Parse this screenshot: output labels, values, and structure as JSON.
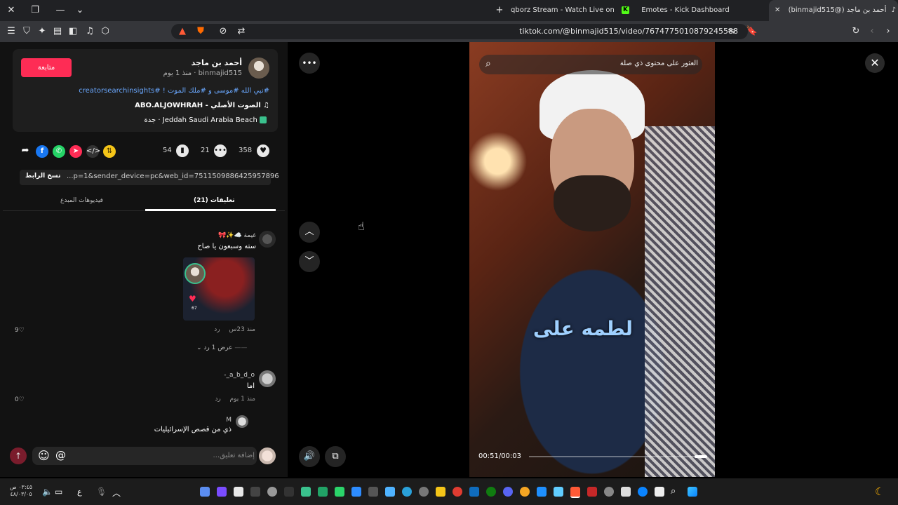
{
  "browser": {
    "tabs": [
      {
        "label": "qborz Stream - Watch Live on Kick"
      },
      {
        "label": "Emotes - Kick Dashboard"
      },
      {
        "label": "(binmajid515@) أحمد بن ماجد"
      }
    ],
    "new_tab": "+",
    "url": "tiktok.com/@binmajid515/video/7674775010879245588"
  },
  "post": {
    "follow_label": "متابعة",
    "author_name": "أحمد بن ماجد",
    "author_meta": "binmajid515 · منذ 1 يوم",
    "caption_tags": "#نبي الله #موسى و #ملك الموت ! #creatorsearchinsights",
    "music": "الصوت الأصلي - ABO.ALJOWHRAH",
    "location": "Jeddah Saudi Arabia Beach · جدة",
    "likes": "358",
    "comments": "21",
    "saves": "54",
    "link_text": "...p=1&sender_device=pc&web_id=7511509886425957896",
    "copy_link_label": "نسخ الرابط"
  },
  "tabs": {
    "comments": "(21) تعليقات",
    "creator_videos": "فيديوهات المبدع"
  },
  "comments": [
    {
      "user": "غيمة ☁️✨🎀",
      "text": "سته وسبعون يا صاح",
      "time": "منذ 23س",
      "reply": "رد",
      "likes": "9",
      "view_replies": "عرض 1 رد",
      "sticker_count": "67"
    },
    {
      "user": "a_b_d_o_-",
      "text": "اما",
      "time": "منذ 1 يوم",
      "reply": "رد",
      "likes": "0"
    },
    {
      "user": "M",
      "text": "ذي من قصص الإسرائيليات"
    }
  ],
  "comment_input": {
    "placeholder": "إضافة تعليق...",
    "mention": "@"
  },
  "video": {
    "search_placeholder": "العثور على محتوى ذي صلة",
    "subtitle": "لطمه على",
    "time": "00:51/00:03"
  },
  "taskbar": {
    "clock_time": "٠٣:٤٥ ص",
    "clock_date": "٤٨/٠٣/٠٥",
    "lang": "ع"
  },
  "colors": {
    "accent": "#fe2c55",
    "link": "#6aa8ff",
    "kick": "#53fc18"
  }
}
